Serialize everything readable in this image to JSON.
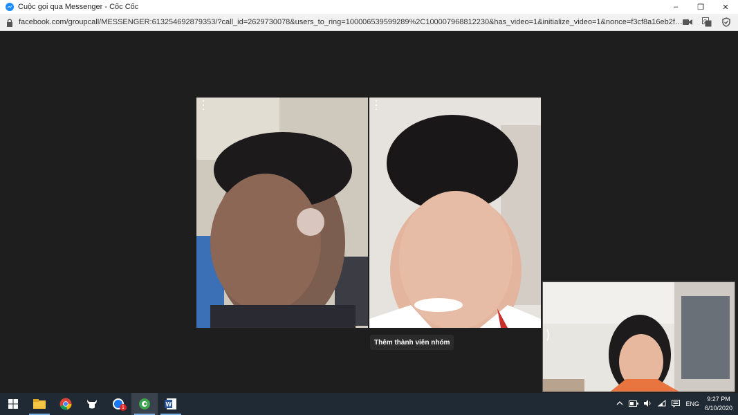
{
  "window": {
    "title": "Cuộc gọi qua Messenger - Cốc Cốc",
    "minimize": "–",
    "restore": "❐",
    "close": "✕"
  },
  "address_bar": {
    "url": "facebook.com/groupcall/MESSENGER:613254692879353/?call_id=2629730078&users_to_ring=100006539599289%2C100007968812230&has_video=1&initialize_video=1&nonce=f3cf8a16eb2fafc..."
  },
  "call": {
    "add_member_tooltip": "Thêm thành viên nhóm",
    "self_chevron": "⟩"
  },
  "taskbar": {
    "lang": "ENG",
    "time": "9:27 PM",
    "date": "6/10/2020",
    "notification_badge": "1"
  }
}
